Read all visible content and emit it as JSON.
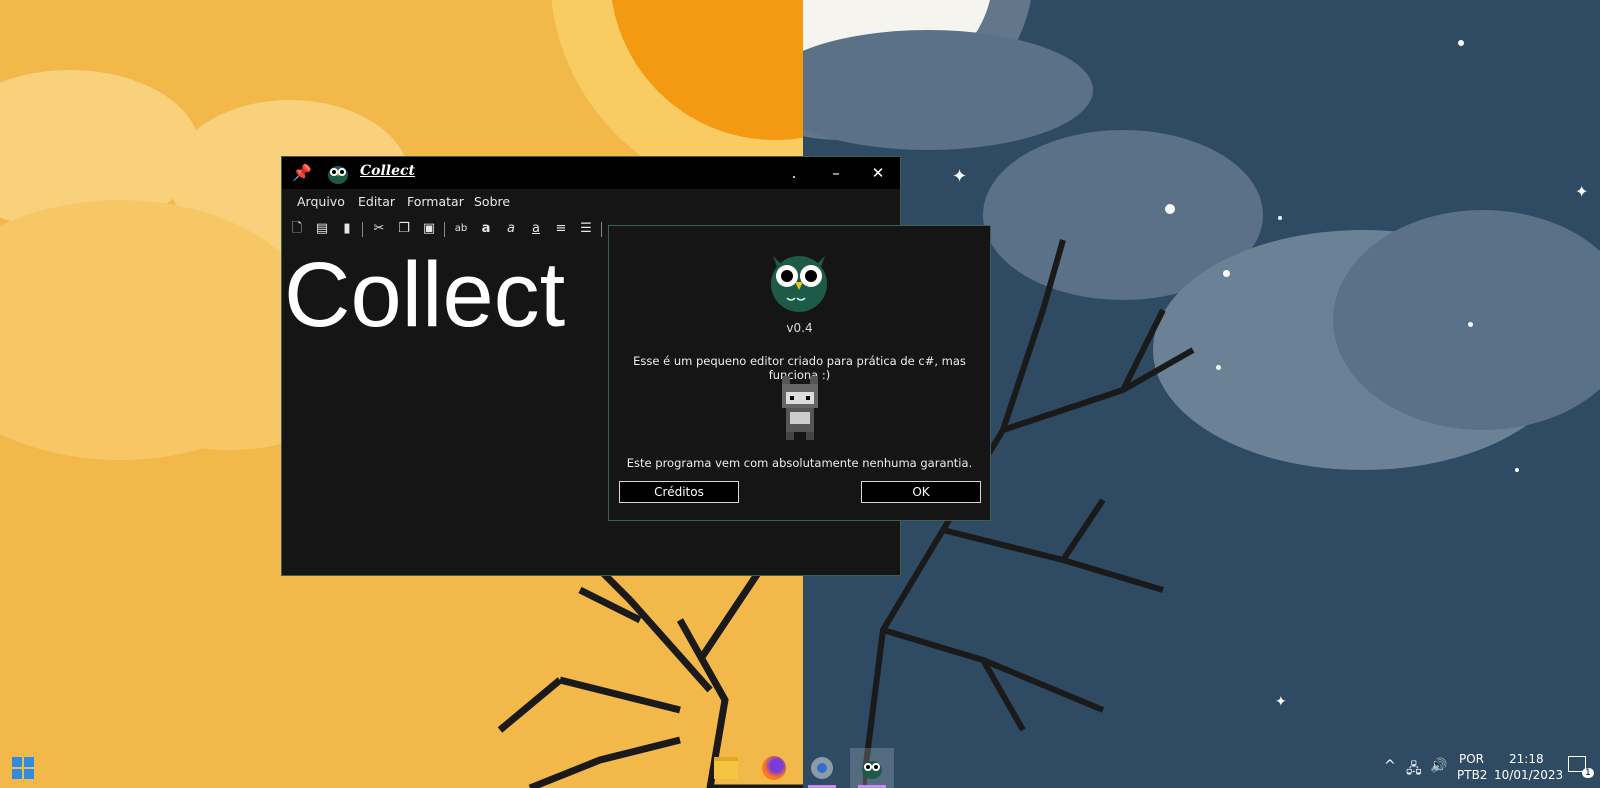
{
  "app": {
    "title": "Collect",
    "menu": [
      "Arquivo",
      "Editar",
      "Formatar",
      "Sobre"
    ],
    "editor_text": "Collect",
    "window_controls": {
      "dot": ".",
      "minimize": "–",
      "close": "✕"
    }
  },
  "about": {
    "version": "v0.4",
    "description": "Esse é um pequeno editor criado para prática de c#, mas funciona :)",
    "warranty": "Este programa vem com absolutamente nenhuma garantia.",
    "credits_button": "Créditos",
    "ok_button": "OK"
  },
  "toolbar": {
    "icons": [
      "new-file-icon",
      "open-folder-icon",
      "save-icon",
      "cut-icon",
      "copy-icon",
      "paste-icon",
      "strikethrough-ab-icon",
      "bold-a-icon",
      "italic-a-icon",
      "underline-a-icon",
      "strike-line-icon",
      "list-icon",
      "align-icon",
      "grid-icon",
      "search-icon"
    ]
  },
  "taskbar": {
    "language_line1": "POR",
    "language_line2": "PTB2",
    "time": "21:18",
    "date": "10/01/2023",
    "notification_count": "1"
  },
  "colors": {
    "accent": "#1e5a48",
    "window_bg": "#151515",
    "window_border": "#3c5e55",
    "wallpaper_day": "#f2b84a",
    "wallpaper_night": "#2f4a63"
  }
}
